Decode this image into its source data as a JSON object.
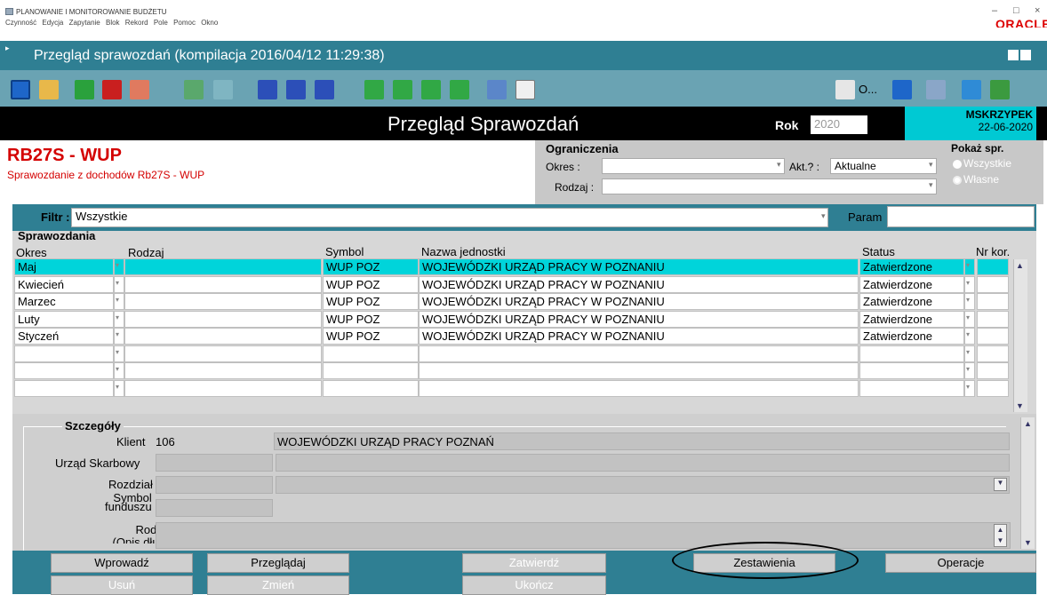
{
  "app": {
    "window_title": "PLANOWANIE I MONITOROWANIE BUDŻETU",
    "menu": [
      "Czynność",
      "Edycja",
      "Zapytanie",
      "Blok",
      "Rekord",
      "Pole",
      "Pomoc",
      "Okno"
    ],
    "brand": "ORACLE",
    "form_title": "Przegląd sprawozdań (kompilacja 2016/04/12 11:29:38)",
    "toolbar_extra": "O..."
  },
  "banner": {
    "title": "Przegląd Sprawozdań",
    "rok_label": "Rok",
    "rok_value": "2020",
    "user": "MSKRZYPEK",
    "date": "22-06-2020"
  },
  "header": {
    "code": "RB27S - WUP",
    "subtitle": "Sprawozdanie z dochodów Rb27S - WUP"
  },
  "ograniczenia": {
    "title": "Ograniczenia",
    "okres_label": "Okres :",
    "okres_value": "",
    "akt_label": "Akt.? :",
    "akt_value": "Aktualne",
    "rodzaj_label": "Rodzaj :",
    "rodzaj_value": ""
  },
  "pokaz": {
    "title": "Pokaż spr.",
    "opt1": "Wszystkie",
    "opt2": "Własne"
  },
  "filter": {
    "label": "Filtr :",
    "value": "Wszystkie",
    "param_label": "Param"
  },
  "sprawozdania": {
    "title": "Sprawozdania",
    "columns": {
      "okres": "Okres",
      "rodzaj": "Rodzaj",
      "symbol": "Symbol",
      "nazwa": "Nazwa jednostki",
      "status": "Status",
      "nrkor": "Nr kor."
    },
    "rows": [
      {
        "okres": "Maj",
        "rodzaj": "",
        "symbol": "WUP POZ",
        "nazwa": "WOJEWÓDZKI URZĄD PRACY W POZNANIU",
        "status": "Zatwierdzone",
        "nrkor": ""
      },
      {
        "okres": "Kwiecień",
        "rodzaj": "",
        "symbol": "WUP POZ",
        "nazwa": "WOJEWÓDZKI URZĄD PRACY W POZNANIU",
        "status": "Zatwierdzone",
        "nrkor": ""
      },
      {
        "okres": "Marzec",
        "rodzaj": "",
        "symbol": "WUP POZ",
        "nazwa": "WOJEWÓDZKI URZĄD PRACY W POZNANIU",
        "status": "Zatwierdzone",
        "nrkor": ""
      },
      {
        "okres": "Luty",
        "rodzaj": "",
        "symbol": "WUP POZ",
        "nazwa": "WOJEWÓDZKI URZĄD PRACY W POZNANIU",
        "status": "Zatwierdzone",
        "nrkor": ""
      },
      {
        "okres": "Styczeń",
        "rodzaj": "",
        "symbol": "WUP POZ",
        "nazwa": "WOJEWÓDZKI URZĄD PRACY W POZNANIU",
        "status": "Zatwierdzone",
        "nrkor": ""
      },
      {
        "okres": "",
        "rodzaj": "",
        "symbol": "",
        "nazwa": "",
        "status": "",
        "nrkor": ""
      },
      {
        "okres": "",
        "rodzaj": "",
        "symbol": "",
        "nazwa": "",
        "status": "",
        "nrkor": ""
      },
      {
        "okres": "",
        "rodzaj": "",
        "symbol": "",
        "nazwa": "",
        "status": "",
        "nrkor": ""
      }
    ]
  },
  "szczegoly": {
    "title": "Szczegóły",
    "klient_label": "Klient",
    "klient_code": "106",
    "klient_name": "WOJEWÓDZKI URZĄD PRACY POZNAŃ",
    "urzad_label": "Urząd Skarbowy",
    "rozdzial_label": "Rozdział",
    "symbol_label1": "Symbol",
    "symbol_label2": "funduszu",
    "rodzaj_label1": "Rodzaj",
    "rodzaj_label2": "(Opis długi)"
  },
  "buttons": {
    "wprowadz": "Wprowadź",
    "przegladaj": "Przeglądaj",
    "zatwierdz": "Zatwierdź",
    "zestawienia": "Zestawienia",
    "operacje": "Operacje",
    "usun": "Usuń",
    "zmien": "Zmień",
    "ukoncz": "Ukończ"
  },
  "colors": {
    "teal": "#2f7f93",
    "cyan_highlight": "#00d4da",
    "red_title": "#d40000"
  }
}
